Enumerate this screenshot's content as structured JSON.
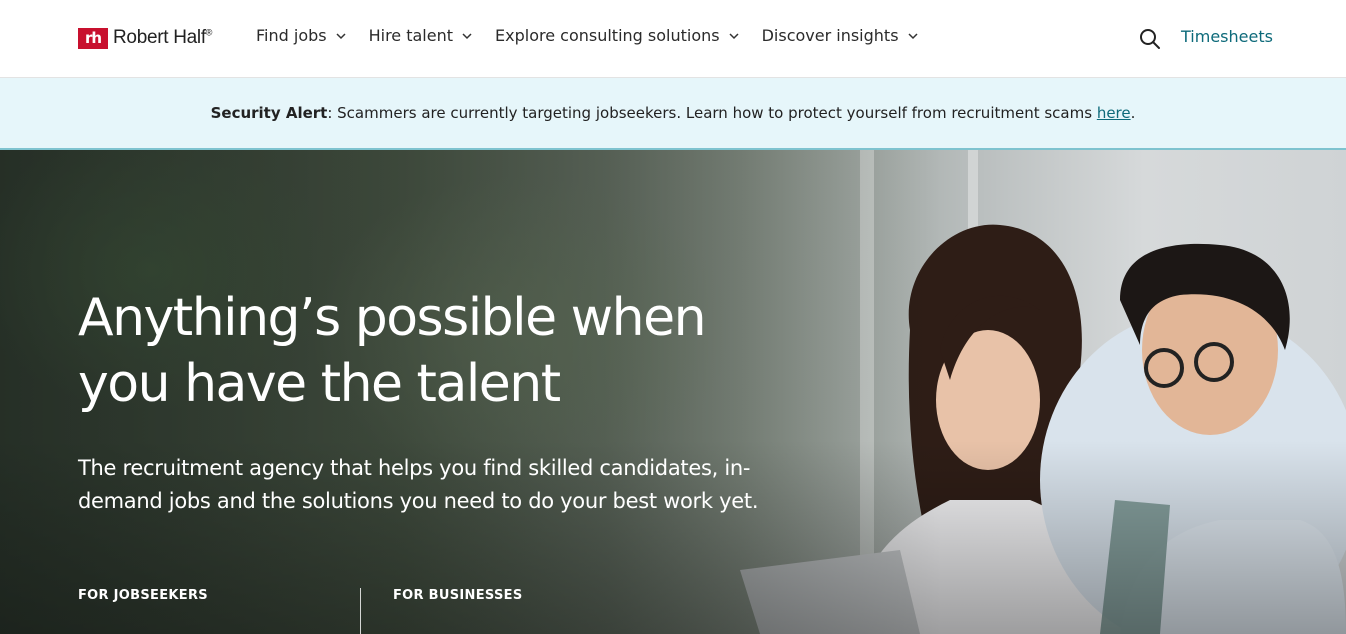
{
  "brand": {
    "mark": "rh",
    "name": "Robert Half",
    "tm": "®"
  },
  "nav": {
    "items": [
      {
        "label": "Find jobs"
      },
      {
        "label": "Hire talent"
      },
      {
        "label": "Explore consulting solutions"
      },
      {
        "label": "Discover insights"
      }
    ],
    "timesheets": "Timesheets"
  },
  "alert": {
    "label": "Security Alert",
    "text": ": Scammers are currently targeting jobseekers. Learn how to protect yourself from recruitment scams ",
    "link": "here",
    "end": "."
  },
  "hero": {
    "title_line1": "Anything’s possible when",
    "title_line2": "you have the talent",
    "subtitle": "The recruitment agency that helps you find skilled candidates, in-demand jobs and the solutions you need to do your best work yet.",
    "jobseekers_label": "FOR JOBSEEKERS",
    "businesses_label": "FOR BUSINESSES"
  },
  "colors": {
    "brand_red": "#c8102e",
    "accent_teal": "#0d6a7a",
    "alert_bg": "#e6f6fa"
  },
  "icons": [
    "chevron-down-icon",
    "search-icon"
  ]
}
